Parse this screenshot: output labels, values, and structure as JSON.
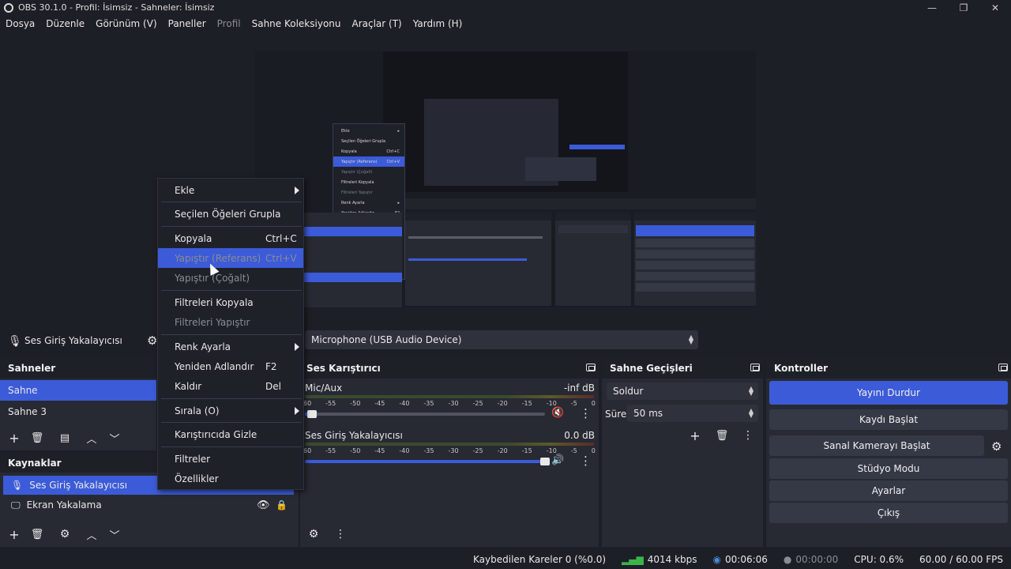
{
  "window": {
    "title": "OBS 30.1.0 - Profil: İsimsiz - Sahneler: İsimsiz",
    "minimize": "—",
    "maximize": "❐",
    "close": "✕"
  },
  "menu": [
    {
      "label": "Dosya",
      "disabled": false
    },
    {
      "label": "Düzenle",
      "disabled": false
    },
    {
      "label": "Görünüm (V)",
      "disabled": false
    },
    {
      "label": "Paneller",
      "disabled": false
    },
    {
      "label": "Profil",
      "disabled": true
    },
    {
      "label": "Sahne Koleksiyonu",
      "disabled": false
    },
    {
      "label": "Araçlar (T)",
      "disabled": false
    },
    {
      "label": "Yardım (H)",
      "disabled": false
    }
  ],
  "source_bar": {
    "source_name": "Ses Giriş Yakalayıcısı",
    "device": "Microphone (USB Audio Device)"
  },
  "scenes": {
    "title": "Sahneler",
    "items": [
      "Sahne",
      "Sahne 3"
    ],
    "selected": 0
  },
  "sources": {
    "title": "Kaynaklar",
    "items": [
      "Ses Giriş Yakalayıcısı",
      "Ekran Yakalama"
    ],
    "selected": 0
  },
  "mixer": {
    "title": "Ses Karıştırıcı",
    "scale": [
      "60",
      "-55",
      "-50",
      "-45",
      "-40",
      "-35",
      "-30",
      "-25",
      "-20",
      "-15",
      "-10",
      "-5",
      "0"
    ],
    "channels": [
      {
        "name": "Mic/Aux",
        "db": "-inf dB",
        "volume": 0.03,
        "muted": true
      },
      {
        "name": "Ses Giriş Yakalayıcısı",
        "db": "0.0 dB",
        "volume": 1.0,
        "muted": false
      }
    ]
  },
  "transitions": {
    "title": "Sahne Geçişleri",
    "type": "Soldur",
    "duration_label": "Süre",
    "duration": "50 ms"
  },
  "controls": {
    "title": "Kontroller",
    "buttons": [
      "Yayını Durdur",
      "Kaydı Başlat",
      "Sanal Kamerayı Başlat",
      "Stüdyo Modu",
      "Ayarlar",
      "Çıkış"
    ]
  },
  "context_menu": {
    "items": [
      {
        "label": "Ekle",
        "shortcut": "",
        "submenu": true,
        "disabled": false,
        "selected": false
      },
      {
        "label": "Seçilen Öğeleri Grupla",
        "shortcut": "",
        "submenu": false,
        "disabled": false,
        "selected": false
      },
      {
        "label": "Kopyala",
        "shortcut": "Ctrl+C",
        "submenu": false,
        "disabled": false,
        "selected": false
      },
      {
        "label": "Yapıştır (Referans)",
        "shortcut": "Ctrl+V",
        "submenu": false,
        "disabled": true,
        "selected": true
      },
      {
        "label": "Yapıştır (Çoğalt)",
        "shortcut": "",
        "submenu": false,
        "disabled": true,
        "selected": false
      },
      {
        "label": "Filtreleri Kopyala",
        "shortcut": "",
        "submenu": false,
        "disabled": false,
        "selected": false
      },
      {
        "label": "Filtreleri Yapıştır",
        "shortcut": "",
        "submenu": false,
        "disabled": true,
        "selected": false
      },
      {
        "label": "Renk Ayarla",
        "shortcut": "",
        "submenu": true,
        "disabled": false,
        "selected": false
      },
      {
        "label": "Yeniden Adlandır",
        "shortcut": "F2",
        "submenu": false,
        "disabled": false,
        "selected": false
      },
      {
        "label": "Kaldır",
        "shortcut": "Del",
        "submenu": false,
        "disabled": false,
        "selected": false
      },
      {
        "label": "Sırala (O)",
        "shortcut": "",
        "submenu": true,
        "disabled": false,
        "selected": false
      },
      {
        "label": "Karıştırıcıda Gizle",
        "shortcut": "",
        "submenu": false,
        "disabled": false,
        "selected": false
      },
      {
        "label": "Filtreler",
        "shortcut": "",
        "submenu": false,
        "disabled": false,
        "selected": false
      },
      {
        "label": "Özellikler",
        "shortcut": "",
        "submenu": false,
        "disabled": false,
        "selected": false
      }
    ]
  },
  "status": {
    "dropped": "Kaybedilen Kareler 0 (%0.0)",
    "bitrate": "4014 kbps",
    "stream_time": "00:06:06",
    "rec_time": "00:00:00",
    "cpu": "CPU: 0.6%",
    "fps": "60.00 / 60.00 FPS"
  },
  "colors": {
    "accent": "#3c5bd8",
    "panel": "#272a33",
    "bg": "#1d1f26",
    "mute_red": "#d22b2b"
  }
}
